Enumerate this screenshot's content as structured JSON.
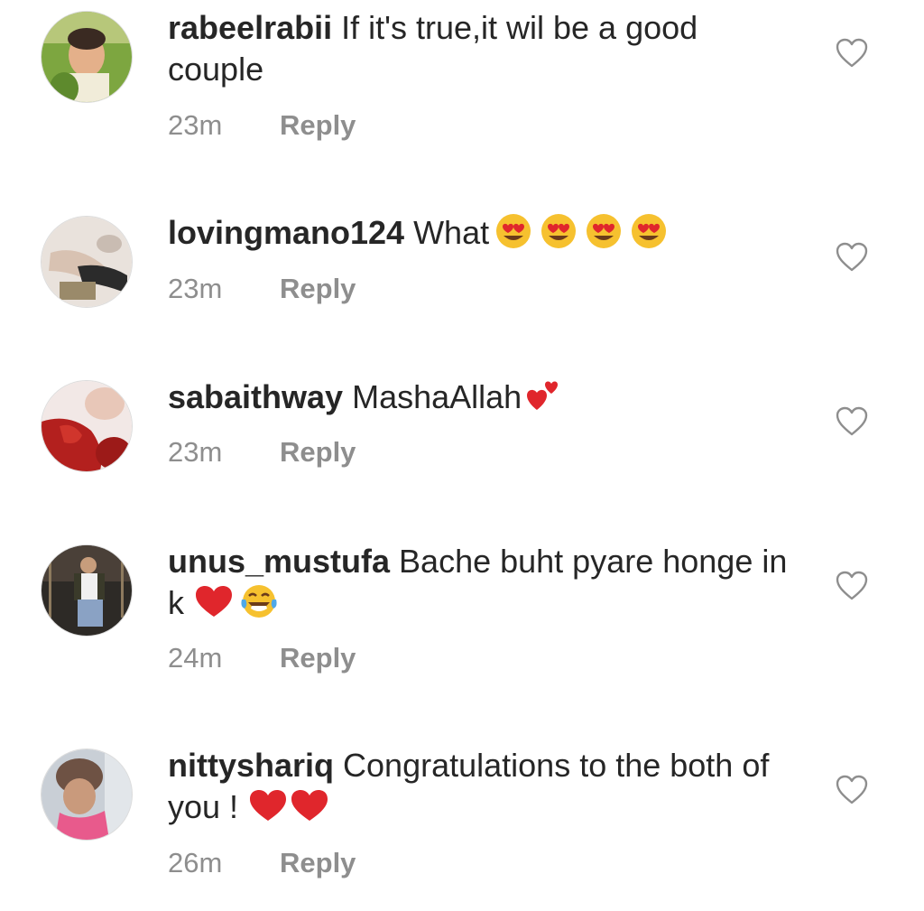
{
  "comments": [
    {
      "username": "rabeelrabii",
      "text": "If it's true,it wil be a good couple",
      "emojis": [],
      "time": "23m",
      "reply": "Reply",
      "avatar": "child-photo-avatar"
    },
    {
      "username": "lovingmano124",
      "text": "What",
      "emojis": [
        "heart-eyes-face",
        "heart-eyes-face",
        "heart-eyes-face",
        "heart-eyes-face"
      ],
      "time": "23m",
      "reply": "Reply",
      "avatar": "hands-photo-avatar"
    },
    {
      "username": "sabaithway",
      "text": "MashaAllah",
      "emojis": [
        "two-hearts"
      ],
      "time": "23m",
      "reply": "Reply",
      "avatar": "red-outfit-photo-avatar"
    },
    {
      "username": "unus_mustufa",
      "text": "Bache buht pyare honge in k",
      "emojis": [
        "red-heart",
        "tears-of-joy-face"
      ],
      "time": "24m",
      "reply": "Reply",
      "avatar": "man-seated-photo-avatar"
    },
    {
      "username": "nittyshariq",
      "text": "Congratulations to the both of you !",
      "emojis": [
        "red-heart",
        "red-heart"
      ],
      "time": "26m",
      "reply": "Reply",
      "avatar": "woman-beanie-photo-avatar"
    }
  ],
  "colors": {
    "text": "#262626",
    "meta": "#8e8e8e",
    "heart_outline": "#8e8e8e",
    "emoji_red": "#e0262c",
    "emoji_yellow": "#f6c12f"
  }
}
